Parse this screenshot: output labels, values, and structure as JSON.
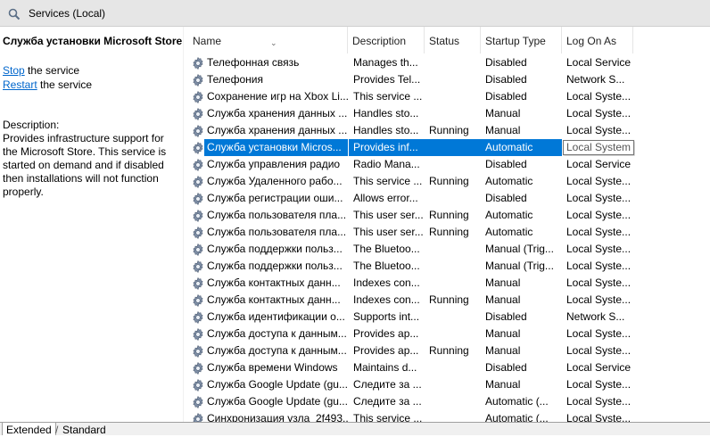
{
  "window": {
    "title": "Services (Local)"
  },
  "left_panel": {
    "service_name": "Служба установки Microsoft Store",
    "stop_link": "Stop",
    "stop_suffix": " the service",
    "restart_link": "Restart",
    "restart_suffix": " the service",
    "description_label": "Description:",
    "description_text": "Provides infrastructure support for the Microsoft Store.  This service is started on demand and if disabled then installations will not function properly."
  },
  "columns": [
    "Name",
    "Description",
    "Status",
    "Startup Type",
    "Log On As"
  ],
  "services": [
    {
      "name": "Телефонная связь",
      "description": "Manages th...",
      "status": "",
      "startup": "Disabled",
      "logon": "Local Service"
    },
    {
      "name": "Телефония",
      "description": "Provides Tel...",
      "status": "",
      "startup": "Disabled",
      "logon": "Network S..."
    },
    {
      "name": "Сохранение игр на Xbox Li...",
      "description": "This service ...",
      "status": "",
      "startup": "Disabled",
      "logon": "Local Syste..."
    },
    {
      "name": "Служба хранения данных ...",
      "description": "Handles sto...",
      "status": "",
      "startup": "Manual",
      "logon": "Local Syste..."
    },
    {
      "name": "Служба хранения данных ...",
      "description": "Handles sto...",
      "status": "Running",
      "startup": "Manual",
      "logon": "Local Syste..."
    },
    {
      "name": "Служба установки Micros...",
      "description": "Provides inf...",
      "status": "",
      "startup": "Automatic",
      "logon": "Local System"
    },
    {
      "name": "Служба управления радио",
      "description": "Radio Mana...",
      "status": "",
      "startup": "Disabled",
      "logon": "Local Service"
    },
    {
      "name": "Служба Удаленного рабо...",
      "description": "This service ...",
      "status": "Running",
      "startup": "Automatic",
      "logon": "Local Syste..."
    },
    {
      "name": "Служба регистрации оши...",
      "description": "Allows error...",
      "status": "",
      "startup": "Disabled",
      "logon": "Local Syste..."
    },
    {
      "name": "Служба пользователя пла...",
      "description": "This user ser...",
      "status": "Running",
      "startup": "Automatic",
      "logon": "Local Syste..."
    },
    {
      "name": "Служба пользователя пла...",
      "description": "This user ser...",
      "status": "Running",
      "startup": "Automatic",
      "logon": "Local Syste..."
    },
    {
      "name": "Служба поддержки польз...",
      "description": "The Bluetoo...",
      "status": "",
      "startup": "Manual (Trig...",
      "logon": "Local Syste..."
    },
    {
      "name": "Служба поддержки польз...",
      "description": "The Bluetoo...",
      "status": "",
      "startup": "Manual (Trig...",
      "logon": "Local Syste..."
    },
    {
      "name": "Служба контактных данн...",
      "description": "Indexes con...",
      "status": "",
      "startup": "Manual",
      "logon": "Local Syste..."
    },
    {
      "name": "Служба контактных данн...",
      "description": "Indexes con...",
      "status": "Running",
      "startup": "Manual",
      "logon": "Local Syste..."
    },
    {
      "name": "Служба идентификации о...",
      "description": "Supports int...",
      "status": "",
      "startup": "Disabled",
      "logon": "Network S..."
    },
    {
      "name": "Служба доступа к данным...",
      "description": "Provides ap...",
      "status": "",
      "startup": "Manual",
      "logon": "Local Syste..."
    },
    {
      "name": "Служба доступа к данным...",
      "description": "Provides ap...",
      "status": "Running",
      "startup": "Manual",
      "logon": "Local Syste..."
    },
    {
      "name": "Служба времени Windows",
      "description": "Maintains d...",
      "status": "",
      "startup": "Disabled",
      "logon": "Local Service"
    },
    {
      "name": "Служба Google Update (gu...",
      "description": "Следите за ...",
      "status": "",
      "startup": "Manual",
      "logon": "Local Syste..."
    },
    {
      "name": "Служба Google Update (gu...",
      "description": "Следите за ...",
      "status": "",
      "startup": "Automatic (...",
      "logon": "Local Syste..."
    },
    {
      "name": "Синхронизация узла_2f493...",
      "description": "This service ...",
      "status": "",
      "startup": "Automatic (...",
      "logon": "Local Syste..."
    }
  ],
  "selected_index": 5,
  "tabs": [
    "Extended",
    "Standard"
  ],
  "colors": {
    "selection": "#0078d7",
    "link": "#0066cc"
  }
}
